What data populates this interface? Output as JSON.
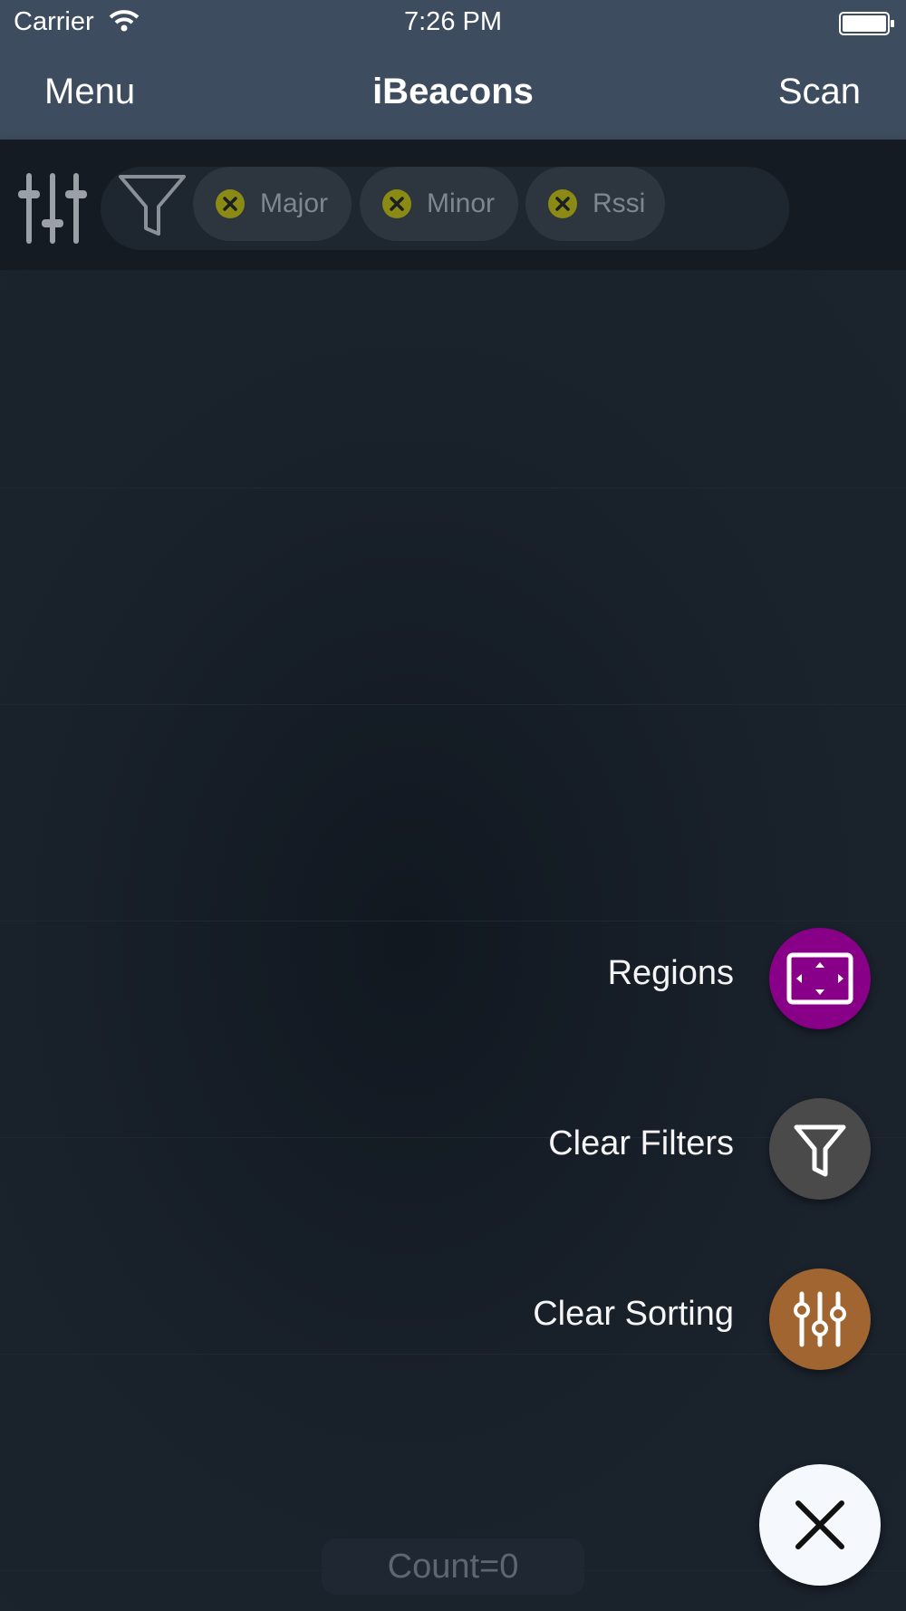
{
  "status_bar": {
    "carrier": "Carrier",
    "time": "7:26 PM",
    "icons": [
      "wifi-icon",
      "battery-icon"
    ]
  },
  "nav": {
    "menu_label": "Menu",
    "title": "iBeacons",
    "scan_label": "Scan"
  },
  "filter_bar": {
    "icons": [
      "sort-sliders-icon",
      "filter-funnel-icon"
    ],
    "chips": [
      {
        "label": "Major",
        "icon": "remove-x-icon"
      },
      {
        "label": "Minor",
        "icon": "remove-x-icon"
      },
      {
        "label": "Rssi",
        "icon": "remove-x-icon"
      }
    ]
  },
  "actions": [
    {
      "label": "Regions",
      "icon": "regions-frame-icon",
      "color": "#880088"
    },
    {
      "label": "Clear Filters",
      "icon": "filter-funnel-icon",
      "color": "#4a4a4a"
    },
    {
      "label": "Clear Sorting",
      "icon": "sort-sliders-icon",
      "color": "#a06530"
    }
  ],
  "close_button": {
    "icon": "close-icon",
    "color": "#f5f8fc"
  },
  "footer": {
    "count_text": "Count=0"
  },
  "colors": {
    "nav_background": "#3d4c5e",
    "content_background": "#19202a",
    "chip_x": "#8a8a14"
  }
}
